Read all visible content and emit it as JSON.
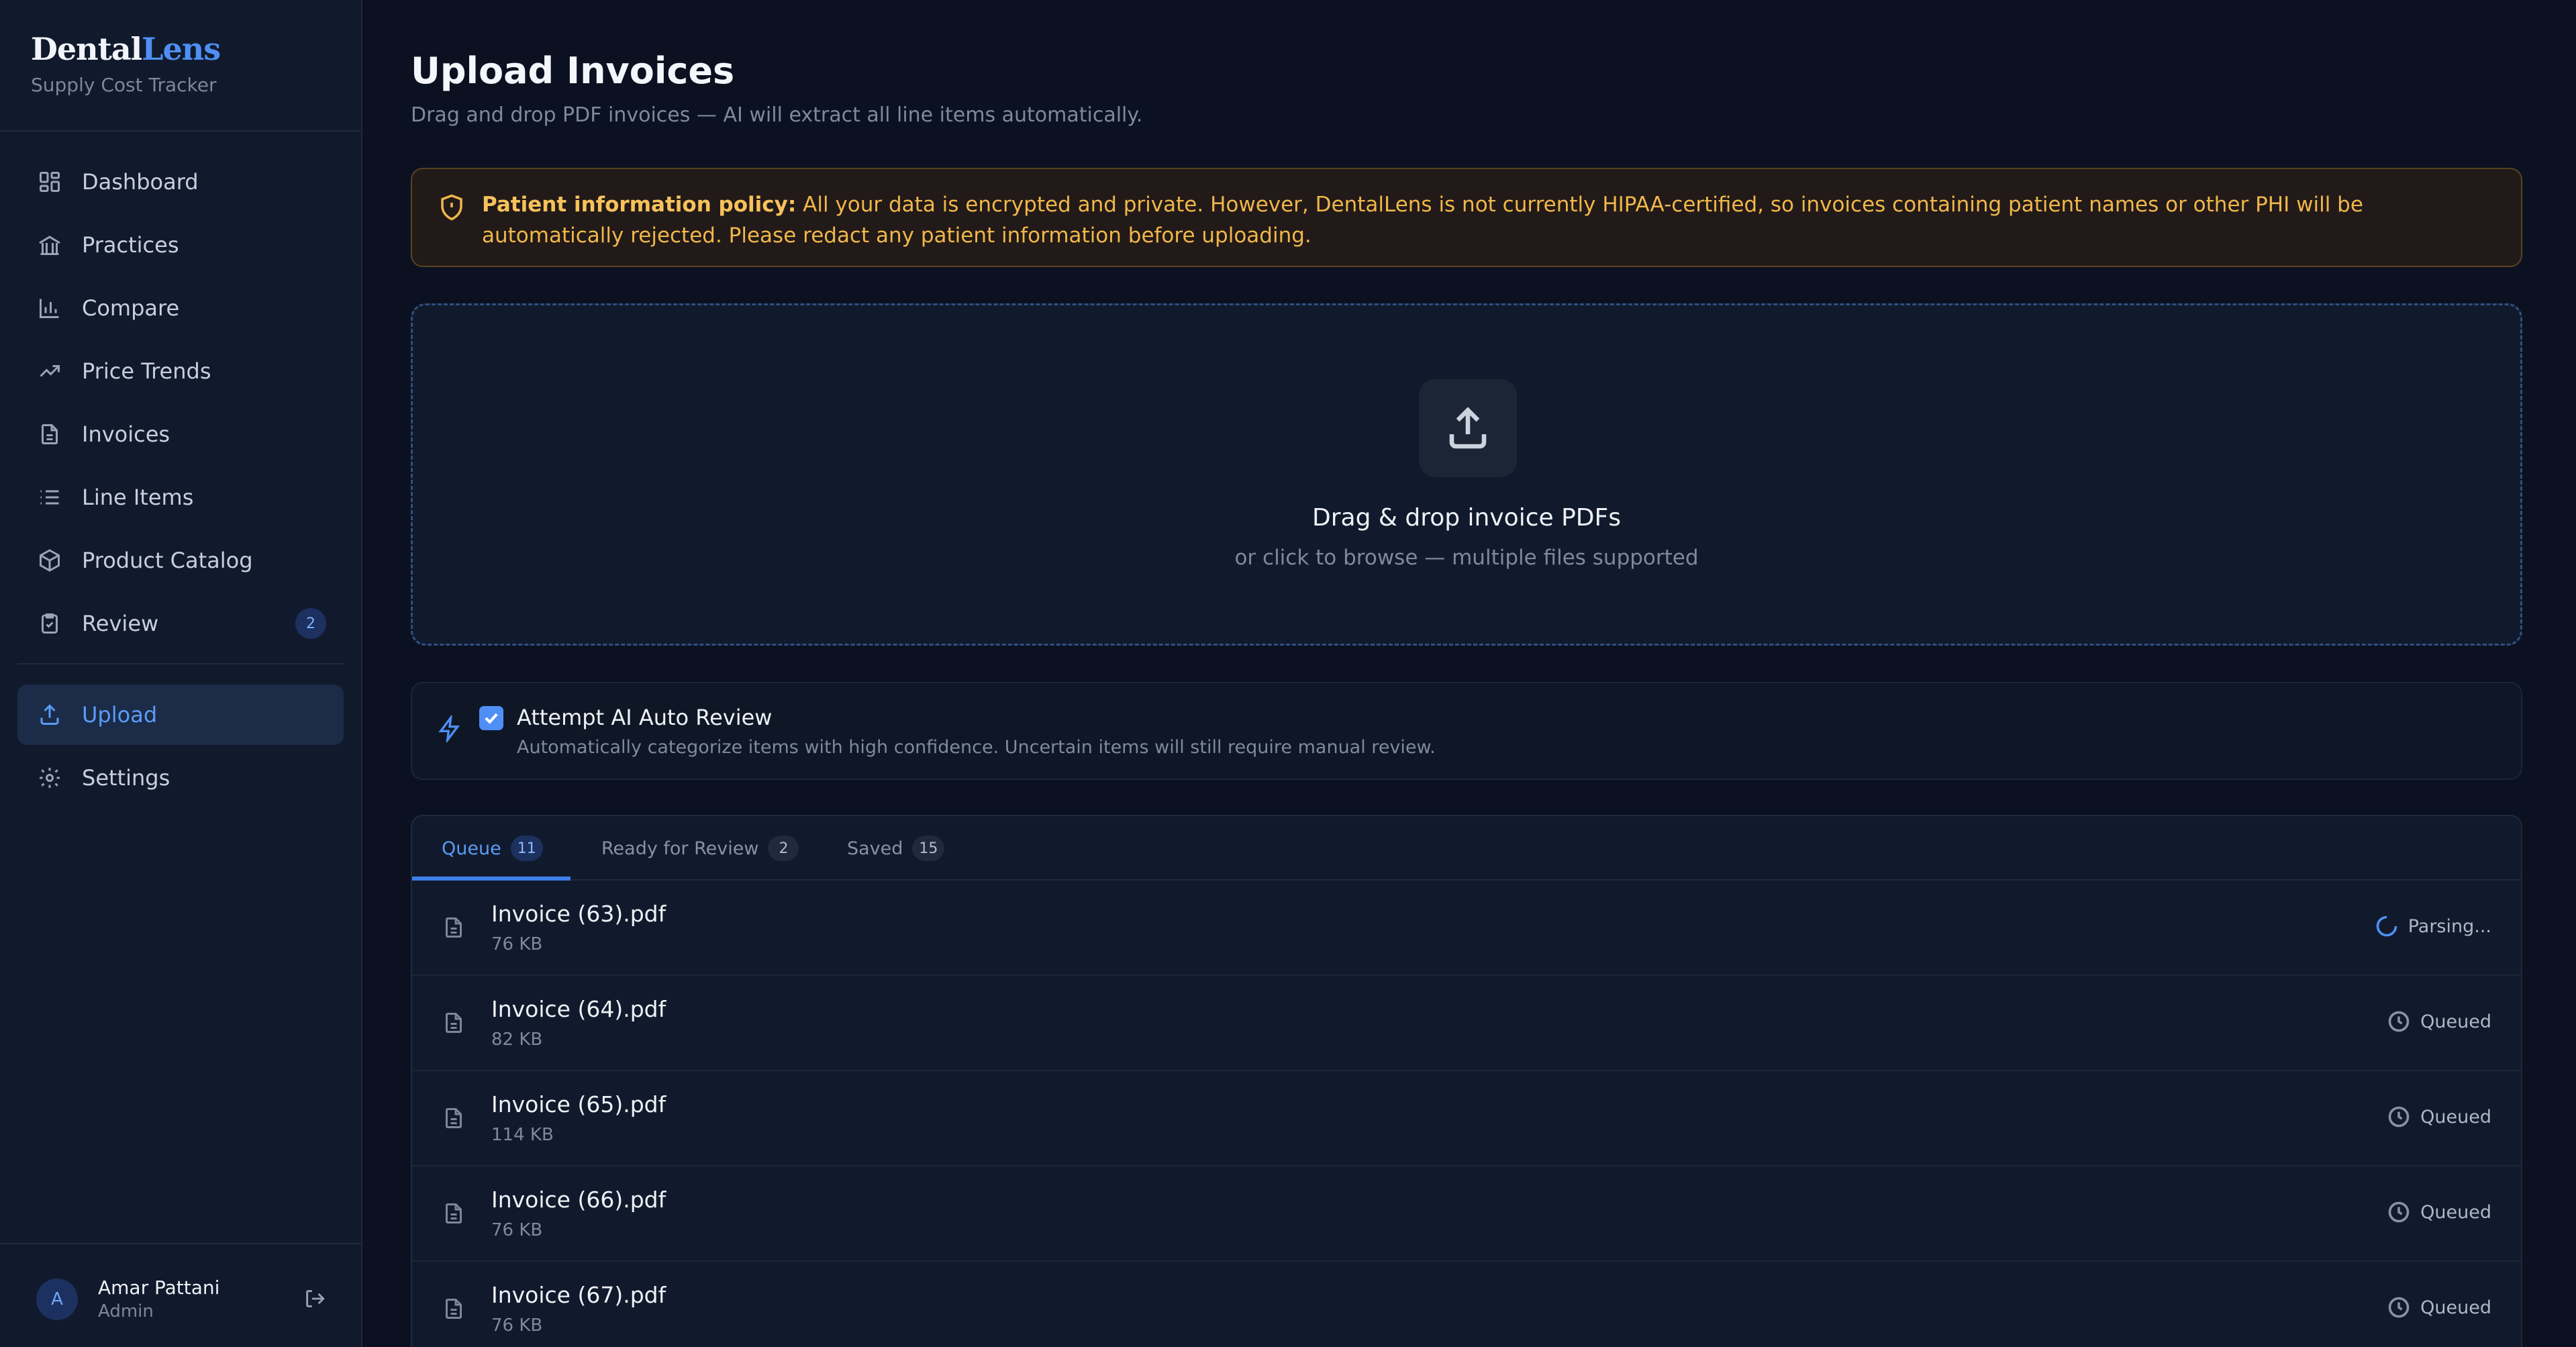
{
  "brand": {
    "name_part1": "Dental",
    "name_part2": "Lens",
    "subtitle": "Supply Cost Tracker"
  },
  "sidebar": {
    "items": [
      {
        "label": "Dashboard",
        "icon": "dashboard-icon"
      },
      {
        "label": "Practices",
        "icon": "building-icon"
      },
      {
        "label": "Compare",
        "icon": "bar-chart-icon"
      },
      {
        "label": "Price Trends",
        "icon": "trend-up-icon"
      },
      {
        "label": "Invoices",
        "icon": "file-icon"
      },
      {
        "label": "Line Items",
        "icon": "list-icon"
      },
      {
        "label": "Product Catalog",
        "icon": "package-icon"
      },
      {
        "label": "Review",
        "icon": "clipboard-check-icon",
        "badge": "2"
      },
      {
        "label": "Upload",
        "icon": "upload-icon",
        "active": true
      },
      {
        "label": "Settings",
        "icon": "gear-icon"
      }
    ]
  },
  "user": {
    "initial": "A",
    "name": "Amar Pattani",
    "role": "Admin"
  },
  "page": {
    "title": "Upload Invoices",
    "subtitle": "Drag and drop PDF invoices — AI will extract all line items automatically."
  },
  "warning": {
    "heading": "Patient information policy:",
    "body": "All your data is encrypted and private. However, DentalLens is not currently HIPAA-certified, so invoices containing patient names or other PHI will be automatically rejected. Please redact any patient information before uploading."
  },
  "dropzone": {
    "title": "Drag & drop invoice PDFs",
    "subtitle": "or click to browse — multiple files supported"
  },
  "ai_review": {
    "checked": true,
    "title": "Attempt AI Auto Review",
    "description": "Automatically categorize items with high confidence. Uncertain items will still require manual review."
  },
  "tabs": [
    {
      "label": "Queue",
      "count": "11",
      "active": true
    },
    {
      "label": "Ready for Review",
      "count": "2"
    },
    {
      "label": "Saved",
      "count": "15"
    }
  ],
  "queue": [
    {
      "name": "Invoice (63).pdf",
      "size": "76 KB",
      "status": "Parsing..."
    },
    {
      "name": "Invoice (64).pdf",
      "size": "82 KB",
      "status": "Queued"
    },
    {
      "name": "Invoice (65).pdf",
      "size": "114 KB",
      "status": "Queued"
    },
    {
      "name": "Invoice (66).pdf",
      "size": "76 KB",
      "status": "Queued"
    },
    {
      "name": "Invoice (67).pdf",
      "size": "76 KB",
      "status": "Queued"
    }
  ],
  "colors": {
    "accent": "#4f8ff5",
    "warning": "#f0b74a",
    "background": "#0b1120",
    "sidebar": "#111a2c"
  }
}
